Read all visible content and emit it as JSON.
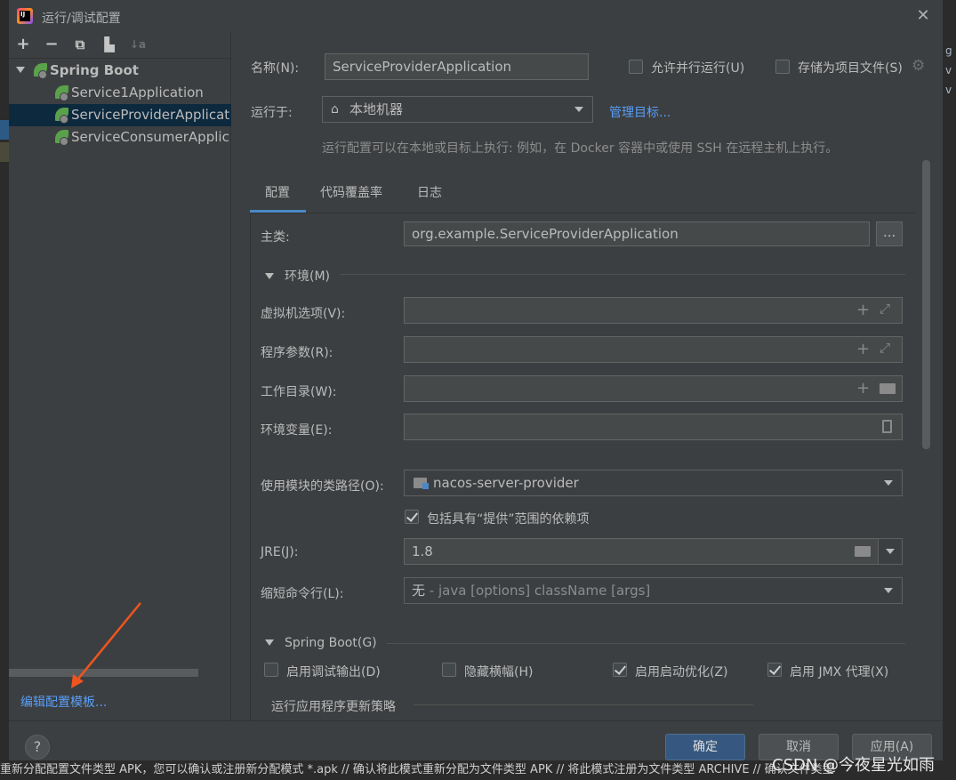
{
  "window": {
    "title": "运行/调试配置",
    "close_icon": "close-icon"
  },
  "toolbar": {
    "add": "+",
    "remove": "−",
    "copy": "⧉",
    "new_folder": "▙",
    "sort": "↓a"
  },
  "tree": {
    "group": "Spring Boot",
    "items": [
      "Service1Application",
      "ServiceProviderApplicat",
      "ServiceConsumerApplic"
    ]
  },
  "edit_templates_link": "编辑配置模板...",
  "name": {
    "label": "名称(N):",
    "value": "ServiceProviderApplication"
  },
  "allow_parallel": {
    "label": "允许并行运行(U)",
    "checked": false
  },
  "store_as_file": {
    "label": "存储为项目文件(S)",
    "checked": false
  },
  "run_on": {
    "label": "运行于:",
    "value": "本地机器",
    "manage_link": "管理目标..."
  },
  "run_hint": "运行配置可以在本地或目标上执行: 例如，在 Docker 容器中或使用 SSH 在远程主机上执行。",
  "tabs": [
    "配置",
    "代码覆盖率",
    "日志"
  ],
  "main_class": {
    "label": "主类:",
    "value": "org.example.ServiceProviderApplication",
    "browse": "..."
  },
  "env_section": "环境(M)",
  "vm_options": {
    "label": "虚拟机选项(V):",
    "value": ""
  },
  "program_args": {
    "label": "程序参数(R):",
    "value": ""
  },
  "work_dir": {
    "label": "工作目录(W):",
    "value": ""
  },
  "env_vars": {
    "label": "环境变量(E):",
    "value": ""
  },
  "classpath": {
    "label": "使用模块的类路径(O):",
    "value": "nacos-server-provider"
  },
  "include_provided": {
    "label": "包括具有“提供”范围的依赖项",
    "checked": true
  },
  "jre": {
    "label": "JRE(J):",
    "value": "1.8"
  },
  "shorten": {
    "label": "缩短命令行(L):",
    "value_main": "无",
    "value_hint": " - java [options] className [args]"
  },
  "spring_section": "Spring Boot(G)",
  "spring_opts": [
    {
      "label": "启用调试输出(D)",
      "checked": false
    },
    {
      "label": "隐藏横幅(H)",
      "checked": false
    },
    {
      "label": "启用启动优化(Z)",
      "checked": true
    },
    {
      "label": "启用 JMX 代理(X)",
      "checked": true
    }
  ],
  "update_policy": "运行应用程序更新策略",
  "buttons": {
    "ok": "确定",
    "cancel": "取消",
    "apply": "应用(A)",
    "help": "?"
  },
  "background_text": "重新分配配置文件类型 APK，您可以确认或注册新分配模式 *.apk // 确认将此模式重新分配为文件类型 APK // 将此模式注册为文件类型 ARCHIVE // 确认文件类型",
  "watermark": "CSDN @今夜星光如雨",
  "right_strip": [
    "g",
    "v",
    "v"
  ]
}
